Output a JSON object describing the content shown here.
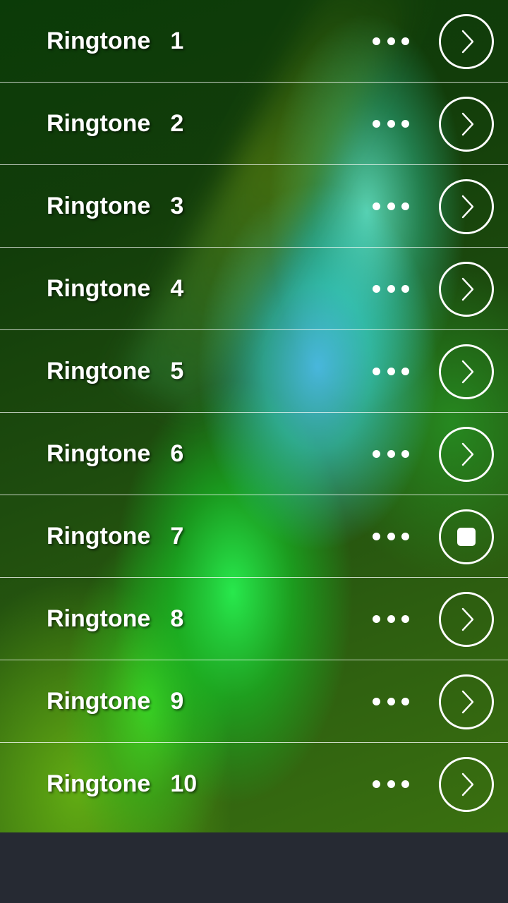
{
  "ringtones": [
    {
      "label": "Ringtone",
      "number": "1",
      "state": "play"
    },
    {
      "label": "Ringtone",
      "number": "2",
      "state": "play"
    },
    {
      "label": "Ringtone",
      "number": "3",
      "state": "play"
    },
    {
      "label": "Ringtone",
      "number": "4",
      "state": "play"
    },
    {
      "label": "Ringtone",
      "number": "5",
      "state": "play"
    },
    {
      "label": "Ringtone",
      "number": "6",
      "state": "play"
    },
    {
      "label": "Ringtone",
      "number": "7",
      "state": "stop"
    },
    {
      "label": "Ringtone",
      "number": "8",
      "state": "play"
    },
    {
      "label": "Ringtone",
      "number": "9",
      "state": "play"
    },
    {
      "label": "Ringtone",
      "number": "10",
      "state": "play"
    }
  ],
  "icons": {
    "menu": "more-dots-icon",
    "play": "chevron-right-circle-icon",
    "stop": "stop-circle-icon"
  },
  "colors": {
    "text": "#ffffff",
    "bottom_bar": "#262a33"
  }
}
